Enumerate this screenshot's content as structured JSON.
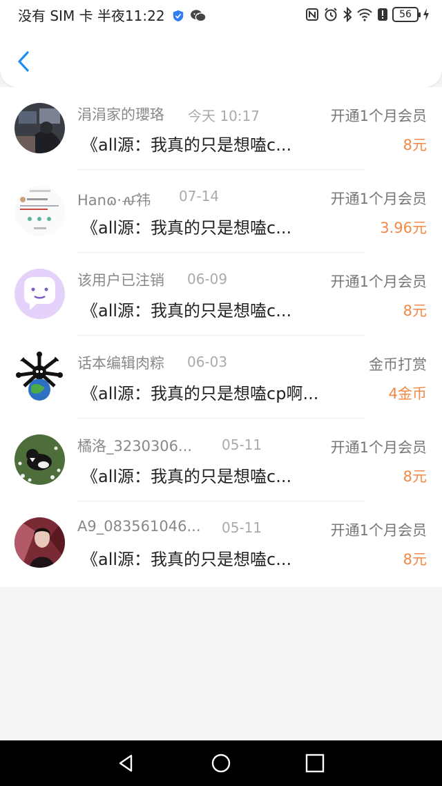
{
  "status_bar": {
    "left_text": "没有 SIM 卡 半夜11:22",
    "battery_level": "56"
  },
  "colors": {
    "accent_blue": "#1f8ef2",
    "amount_orange": "#f18844",
    "background": "#f5f4f5"
  },
  "records": [
    {
      "name": "涓涓家的瓔珞",
      "date": "今天 10:17",
      "title": "《all源：我真的只是想嗑c...",
      "type": "开通1个月会员",
      "amount": "8元"
    },
    {
      "name": "Hanɷ·ꫛ祎",
      "date": "07-14",
      "title": "《all源：我真的只是想嗑c...",
      "type": "开通1个月会员",
      "amount": "3.96元"
    },
    {
      "name": "该用户已注销",
      "date": "06-09",
      "title": "《all源：我真的只是想嗑c...",
      "type": "开通1个月会员",
      "amount": "8元"
    },
    {
      "name": "话本编辑肉粽",
      "date": "06-03",
      "title": "《all源：我真的只是想嗑cp啊...",
      "type": "金币打赏",
      "amount": "4金币"
    },
    {
      "name": "橘洛_3230306...",
      "date": "05-11",
      "title": "《all源：我真的只是想嗑c...",
      "type": "开通1个月会员",
      "amount": "8元"
    },
    {
      "name": "A9_083561046...",
      "date": "05-11",
      "title": "《all源：我真的只是想嗑c...",
      "type": "开通1个月会员",
      "amount": "8元"
    }
  ],
  "nav": {
    "icons": [
      "back-triangle-icon",
      "home-circle-icon",
      "recents-square-icon"
    ]
  }
}
